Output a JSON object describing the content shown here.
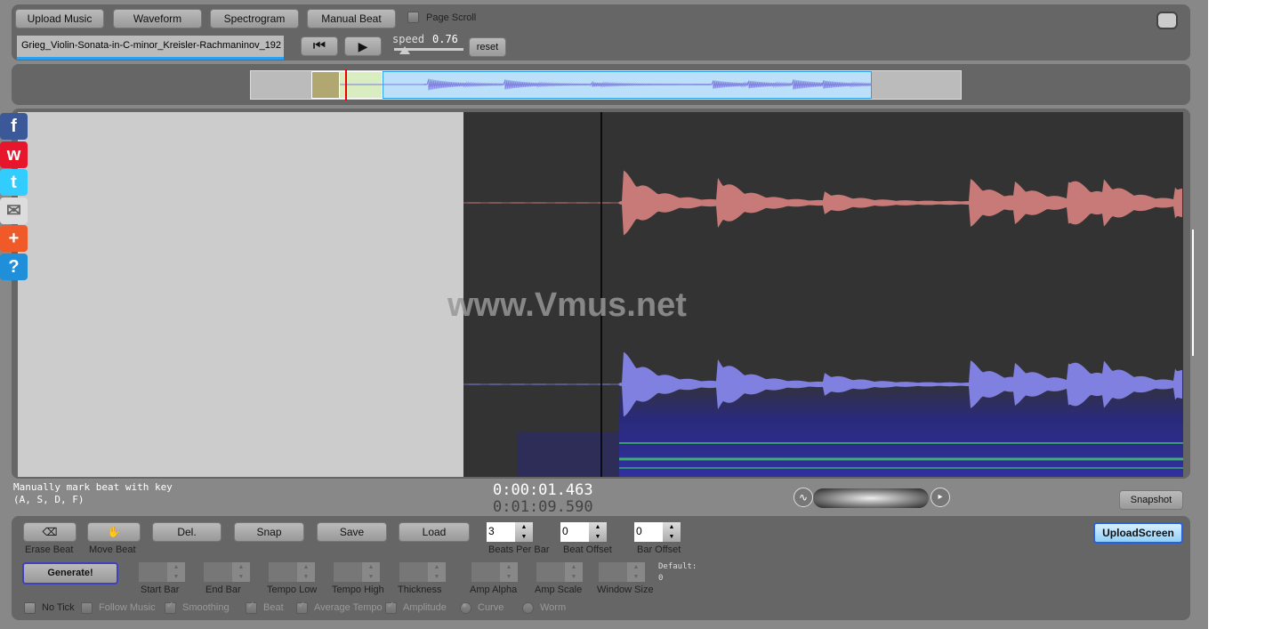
{
  "toolbar": {
    "upload_music": "Upload Music",
    "waveform": "Waveform",
    "spectrogram": "Spectrogram",
    "manual_beat": "Manual Beat",
    "page_scroll": "Page Scroll",
    "filename": "Grieg_Violin-Sonata-in-C-minor_Kreisler-Rachmaninov_192",
    "speed_label": "speed",
    "speed_value": "0.76",
    "reset": "reset"
  },
  "watermark": "www.Vmus.net",
  "status": {
    "hint_line1": "Manually mark beat with key",
    "hint_line2": "(A, S, D, F)",
    "current_time": "0:00:01.463",
    "total_time": "0:01:09.590",
    "snapshot": "Snapshot"
  },
  "social": [
    {
      "icon": "facebook-icon",
      "label": "f"
    },
    {
      "icon": "weibo-icon",
      "label": "w"
    },
    {
      "icon": "twitter-icon",
      "label": "t"
    },
    {
      "icon": "mail-icon",
      "label": "✉"
    },
    {
      "icon": "plus-icon",
      "label": "+"
    },
    {
      "icon": "help-icon",
      "label": "?"
    }
  ],
  "beat": {
    "erase": "Erase Beat",
    "move": "Move Beat",
    "del": "Del.",
    "snap": "Snap",
    "save": "Save",
    "load": "Load",
    "beats_per_bar_label": "Beats Per Bar",
    "beats_per_bar": "3",
    "beat_offset_label": "Beat Offset",
    "beat_offset": "0",
    "bar_offset_label": "Bar Offset",
    "bar_offset": "0",
    "upload_screen": "UploadScreen",
    "generate": "Generate!",
    "params": [
      "Start Bar",
      "End Bar",
      "Tempo Low",
      "Tempo High",
      "Thickness",
      "Amp Alpha",
      "Amp Scale",
      "Window Size"
    ],
    "default_label": "Default:",
    "default_value": "0",
    "options": [
      {
        "label": "No Tick",
        "type": "checkbox",
        "checked": false,
        "enabled": true
      },
      {
        "label": "Follow Music",
        "type": "checkbox",
        "checked": false,
        "enabled": false
      },
      {
        "label": "Smoothing",
        "type": "checkbox",
        "checked": true,
        "enabled": false
      },
      {
        "label": "Beat",
        "type": "checkbox",
        "checked": true,
        "enabled": false
      },
      {
        "label": "Average Tempo",
        "type": "checkbox",
        "checked": true,
        "enabled": false
      },
      {
        "label": "Amplitude",
        "type": "checkbox",
        "checked": true,
        "enabled": false
      },
      {
        "label": "Curve",
        "type": "radio",
        "checked": true,
        "enabled": false
      },
      {
        "label": "Worm",
        "type": "radio",
        "checked": false,
        "enabled": false
      }
    ]
  },
  "colors": {
    "accent": "#2aa0f0",
    "wave_top": "#c87a78",
    "wave_bottom": "#8080e0",
    "spectrogram": "#2a2a8a"
  }
}
